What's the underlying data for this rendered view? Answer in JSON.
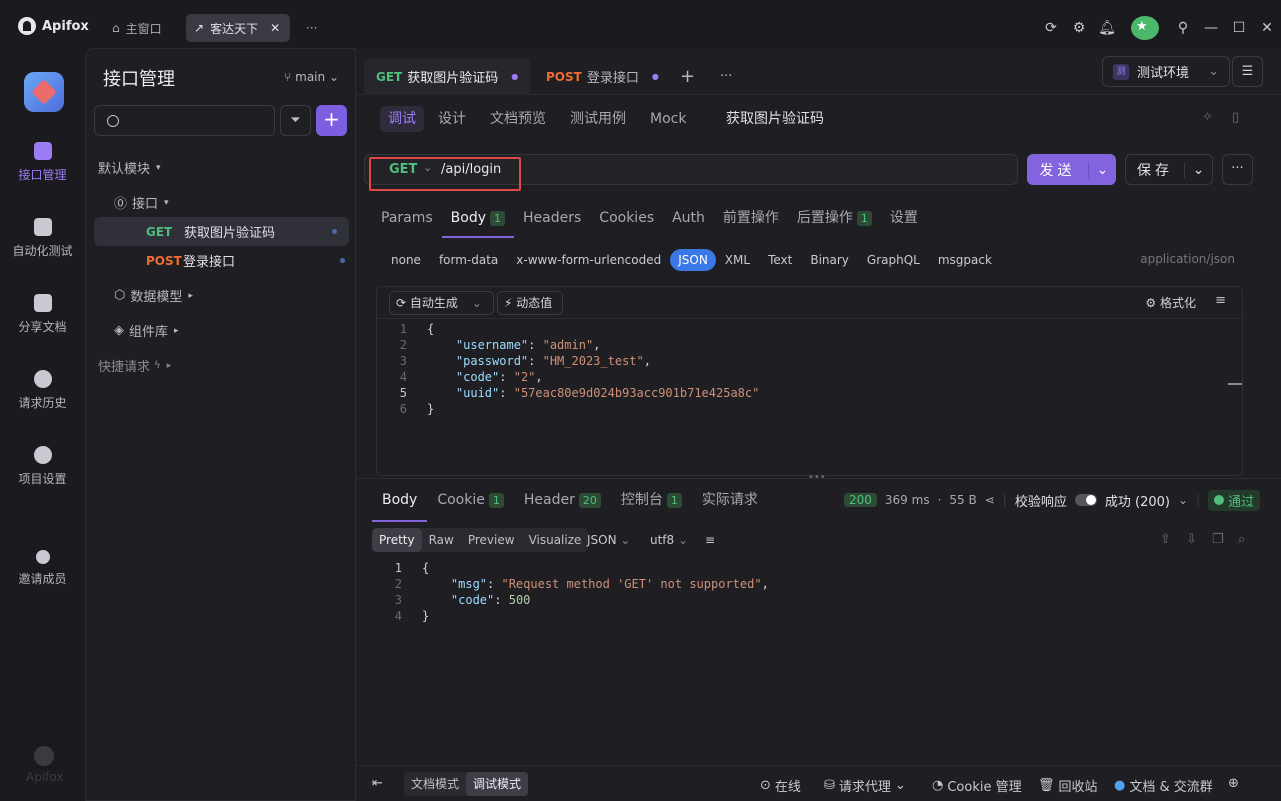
{
  "window": {
    "app_name": "Apifox",
    "tabs": [
      {
        "label": "主窗口"
      },
      {
        "label": "客达天下"
      }
    ],
    "more_label": "···"
  },
  "leftnav": {
    "items": [
      {
        "label": "接口管理",
        "icon": "api-icon",
        "active": true
      },
      {
        "label": "自动化测试",
        "icon": "automation-icon"
      },
      {
        "label": "分享文档",
        "icon": "book-icon"
      },
      {
        "label": "请求历史",
        "icon": "history-icon"
      },
      {
        "label": "项目设置",
        "icon": "settings-icon"
      },
      {
        "label": "邀请成员",
        "icon": "add-user-icon"
      }
    ],
    "bottom_brand": "Apifox"
  },
  "sidebar": {
    "title": "接口管理",
    "branch": "main",
    "tree": {
      "default_module": "默认模块",
      "api_folder": "接口",
      "apis": [
        {
          "method": "GET",
          "name": "获取图片验证码",
          "selected": true
        },
        {
          "method": "POST",
          "name": "登录接口"
        }
      ],
      "data_model": "数据模型",
      "components": "组件库",
      "quick_request": "快捷请求"
    }
  },
  "request_tabs": [
    {
      "method": "GET",
      "name": "获取图片验证码",
      "active": true
    },
    {
      "method": "POST",
      "name": "登录接口"
    }
  ],
  "environment": {
    "badge": "测",
    "label": "测试环境"
  },
  "sub_tabs": [
    "调试",
    "设计",
    "文档预览",
    "测试用例",
    "Mock"
  ],
  "sub_title": "获取图片验证码",
  "request": {
    "method": "GET",
    "url": "/api/login",
    "send_label": "发送",
    "save_label": "保存"
  },
  "param_tabs": [
    {
      "label": "Params"
    },
    {
      "label": "Body",
      "badge": "1",
      "active": true
    },
    {
      "label": "Headers"
    },
    {
      "label": "Cookies"
    },
    {
      "label": "Auth"
    },
    {
      "label": "前置操作"
    },
    {
      "label": "后置操作",
      "badge": "1"
    },
    {
      "label": "设置"
    }
  ],
  "body_types": [
    "none",
    "form-data",
    "x-www-form-urlencoded",
    "JSON",
    "XML",
    "Text",
    "Binary",
    "GraphQL",
    "msgpack"
  ],
  "body_type_active": "JSON",
  "content_type": "application/json",
  "editor_toolbar": {
    "auto_generate": "自动生成",
    "dynamic_value": "动态值",
    "format": "格式化"
  },
  "request_body_lines": [
    "{",
    "    \"username\": \"admin\",",
    "    \"password\": \"HM_2023_test\",",
    "    \"code\": \"2\",",
    "    \"uuid\": \"57eac80e9d024b93acc901b71e425a8c\"",
    "}"
  ],
  "response_tabs": [
    {
      "label": "Body",
      "active": true
    },
    {
      "label": "Cookie",
      "badge": "1"
    },
    {
      "label": "Header",
      "badge": "20"
    },
    {
      "label": "控制台",
      "badge": "1"
    },
    {
      "label": "实际请求"
    }
  ],
  "response_info": {
    "status": "200",
    "time": "369 ms",
    "size": "55 B",
    "validate_label": "校验响应",
    "result": "成功 (200)",
    "pass_label": "通过"
  },
  "response_views": [
    "Pretty",
    "Raw",
    "Preview",
    "Visualize"
  ],
  "response_view_active": "Pretty",
  "response_format": "JSON",
  "response_encoding": "utf8",
  "response_body_lines": [
    "{",
    "    \"msg\": \"Request method 'GET' not supported\",",
    "    \"code\": 500",
    "}"
  ],
  "statusbar": {
    "doc_mode": "文档模式",
    "debug_mode": "调试模式",
    "online": "在线",
    "proxy": "请求代理",
    "cookie": "Cookie 管理",
    "trash": "回收站",
    "community": "文档 & 交流群"
  }
}
